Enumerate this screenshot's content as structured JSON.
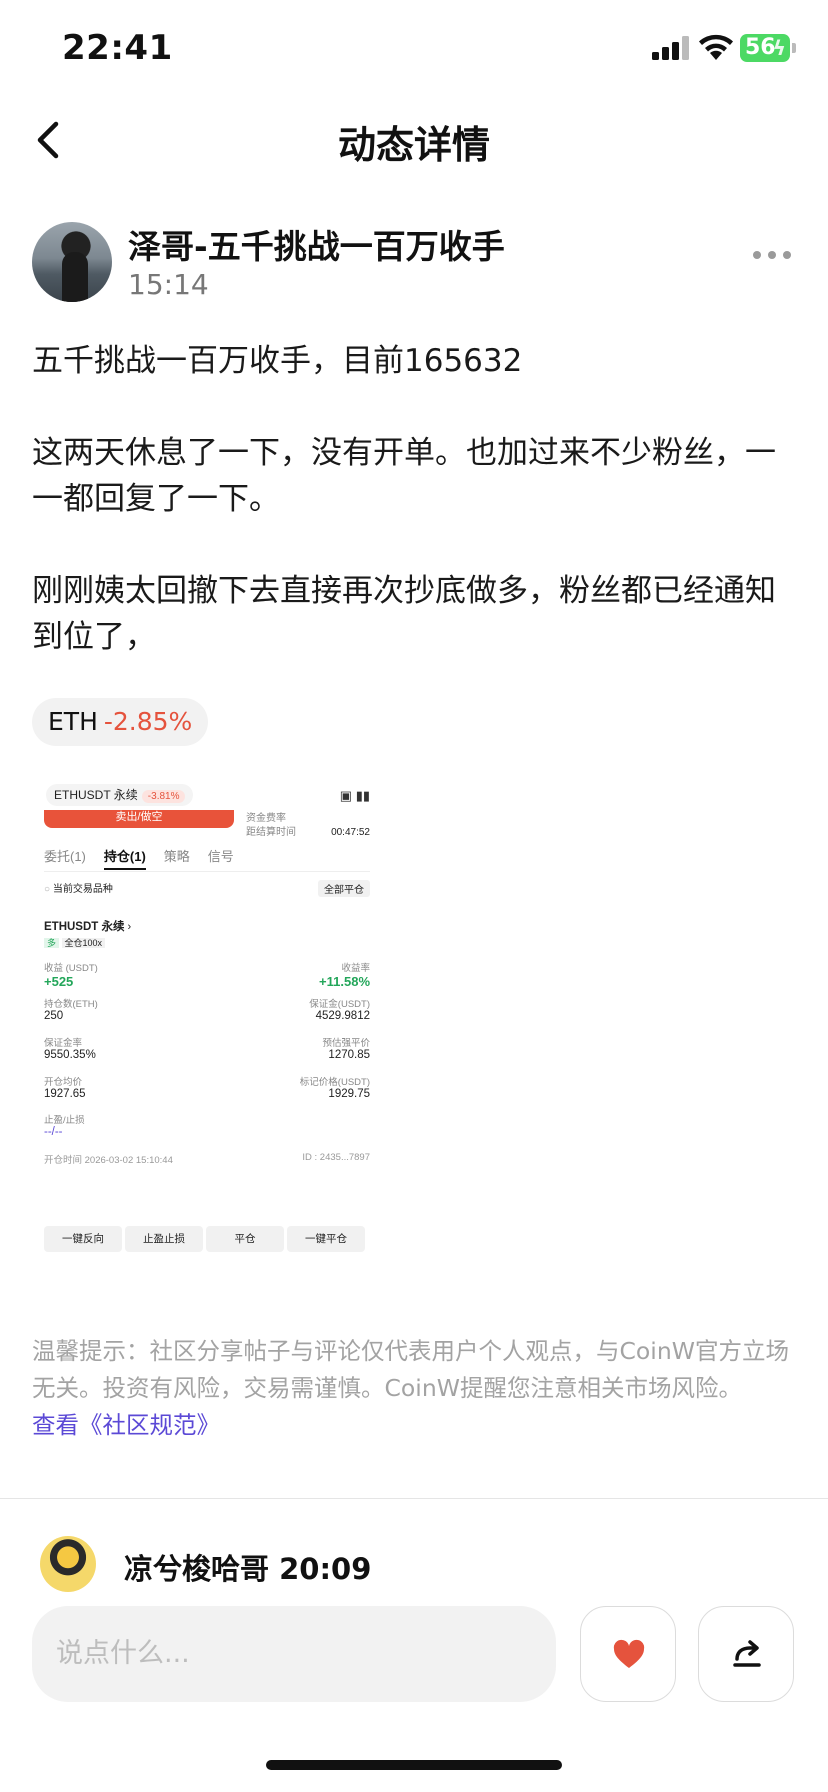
{
  "status_bar": {
    "time": "22:41",
    "battery": "56"
  },
  "nav": {
    "title": "动态详情"
  },
  "post": {
    "author": "泽哥-五千挑战一百万收手",
    "time": "15:14",
    "paragraphs": [
      "五千挑战一百万收手，目前165632",
      "这两天休息了一下，没有开单。也加过来不少粉丝，一一都回复了一下。",
      "刚刚姨太回撤下去直接再次抄底做多，粉丝都已经通知到位了，"
    ],
    "coin": {
      "symbol": "ETH",
      "change": "-2.85%"
    }
  },
  "screenshot": {
    "pair": "ETHUSDT 永续",
    "pair_change": "-3.81%",
    "sell_label": "卖出/做空",
    "funding_label": "资金费率",
    "countdown_label": "距结算时间",
    "countdown": "00:47:52",
    "tabs": [
      "委托(1)",
      "持仓(1)",
      "策略",
      "信号"
    ],
    "current_only": "当前交易品种",
    "close_all": "全部平仓",
    "position_pair": "ETHUSDT 永续",
    "side_tag": "多",
    "leverage_tag": "全仓100x",
    "pnl_label": "收益 (USDT)",
    "pnl": "+525",
    "roi_label": "收益率",
    "roi": "+11.58%",
    "size_label": "持仓数(ETH)",
    "size": "250",
    "margin_label": "保证金(USDT)",
    "margin": "4529.9812",
    "margin_ratio_label": "保证金率",
    "margin_ratio": "9550.35%",
    "liq_label": "预估强平价",
    "liq": "1270.85",
    "entry_label": "开仓均价",
    "entry": "1927.65",
    "mark_label": "标记价格(USDT)",
    "mark": "1929.75",
    "tpsl_label": "止盈/止损",
    "tpsl": "--/--",
    "open_time": "开仓时间 2026-03-02 15:10:44",
    "id": "ID : 2435...7897",
    "buttons": [
      "一键反向",
      "止盈止损",
      "平仓",
      "一键平仓"
    ]
  },
  "notice": {
    "text": "温馨提示：社区分享帖子与评论仅代表用户个人观点，与CoinW官方立场无关。投资有风险，交易需谨慎。CoinW提醒您注意相关市场风险。",
    "link": "查看《社区规范》"
  },
  "comment": {
    "author_time": "凉兮梭哈哥 20:09"
  },
  "composer": {
    "placeholder": "说点什么..."
  },
  "colors": {
    "accent_red": "#e5533d",
    "link": "#5b49d6",
    "green": "#23a65a"
  }
}
